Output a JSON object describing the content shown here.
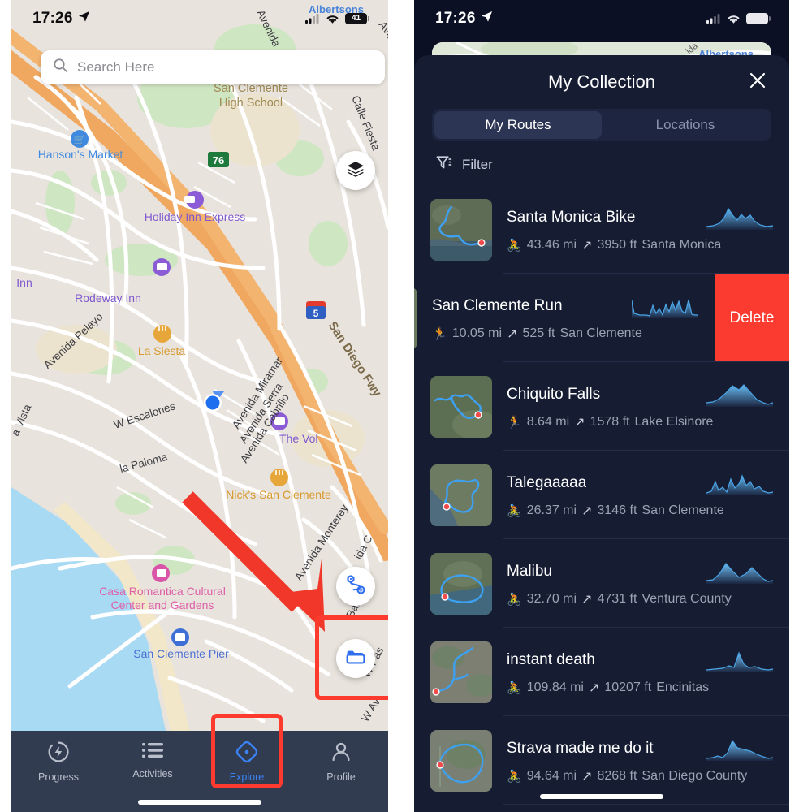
{
  "left_phone": {
    "status": {
      "time": "17:26",
      "location_arrow": "location-arrow-icon",
      "battery": "41"
    },
    "search": {
      "placeholder": "Search Here",
      "icon": "search-icon"
    },
    "buttons": {
      "layers": "layers-icon",
      "create_route": "route-add-icon",
      "collection_folder": "folder-icon"
    },
    "map_labels": [
      "Albertsons",
      "San Clemente High School",
      "Hanson's Market",
      "Holiday Inn Express",
      "Rodeway Inn",
      "Inn",
      "La Siesta",
      "Avenida Pelayo",
      "W Escalones",
      "la Paloma",
      "a Vista",
      "Avenida Miramar",
      "Avenida Serra",
      "Avenida Cabrillo",
      "The Vol",
      "Nick's San Clemente",
      "Casa Romantica Cultural Center and Gardens",
      "San Clemente Pier",
      "Avenida Monterey",
      "Avenida Barcelo",
      "W Pas",
      "W Av",
      "Calle Fiesta",
      "Avenida",
      "San Diego Fwy",
      "76",
      "5"
    ],
    "tabbar": [
      {
        "label": "Progress",
        "icon": "progress-bolt-icon",
        "active": false
      },
      {
        "label": "Activities",
        "icon": "list-icon",
        "active": false
      },
      {
        "label": "Explore",
        "icon": "explore-compass-icon",
        "active": true
      },
      {
        "label": "Profile",
        "icon": "person-icon",
        "active": false
      }
    ],
    "annotations": {
      "arrow_color": "#f0372a",
      "highlight_color": "#fc3a2d",
      "highlighted": [
        "collection_folder_button",
        "explore_tab"
      ]
    }
  },
  "right_phone": {
    "status": {
      "time": "17:26",
      "location_arrow": "location-arrow-icon",
      "battery": ""
    },
    "background_peek": {
      "label": "Albertsons",
      "label2": "ida"
    },
    "sheet": {
      "title": "My Collection",
      "close_icon": "close-icon",
      "tabs": [
        {
          "label": "My Routes",
          "selected": true
        },
        {
          "label": "Locations",
          "selected": false
        }
      ],
      "filter": {
        "label": "Filter",
        "icon": "filter-icon"
      },
      "routes": [
        {
          "name": "Santa Monica Bike",
          "activity": "bike",
          "distance": "43.46 mi",
          "elevation": "3950 ft",
          "location": "Santa Monica",
          "swiped": false
        },
        {
          "name": "San Clemente Run",
          "activity": "run",
          "distance": "10.05 mi",
          "elevation": "525 ft",
          "location": "San Clemente",
          "swiped": true,
          "delete_label": "Delete"
        },
        {
          "name": "Chiquito Falls",
          "activity": "run",
          "distance": "8.64 mi",
          "elevation": "1578 ft",
          "location": "Lake Elsinore",
          "swiped": false
        },
        {
          "name": "Talegaaaaa",
          "activity": "bike",
          "distance": "26.37 mi",
          "elevation": "3146 ft",
          "location": "San Clemente",
          "swiped": false
        },
        {
          "name": "Malibu",
          "activity": "bike",
          "distance": "32.70 mi",
          "elevation": "4731 ft",
          "location": "Ventura County",
          "swiped": false
        },
        {
          "name": "instant death",
          "activity": "bike",
          "distance": "109.84 mi",
          "elevation": "10207 ft",
          "location": "Encinitas",
          "swiped": false
        },
        {
          "name": "Strava made me do it",
          "activity": "bike",
          "distance": "94.64 mi",
          "elevation": "8268 ft",
          "location": "San Diego County",
          "swiped": false
        }
      ]
    },
    "colors": {
      "sheet_bg": "#161d33",
      "page_bg": "#0b1024",
      "delete": "#fc3b30",
      "accent": "#3b82f6"
    }
  }
}
